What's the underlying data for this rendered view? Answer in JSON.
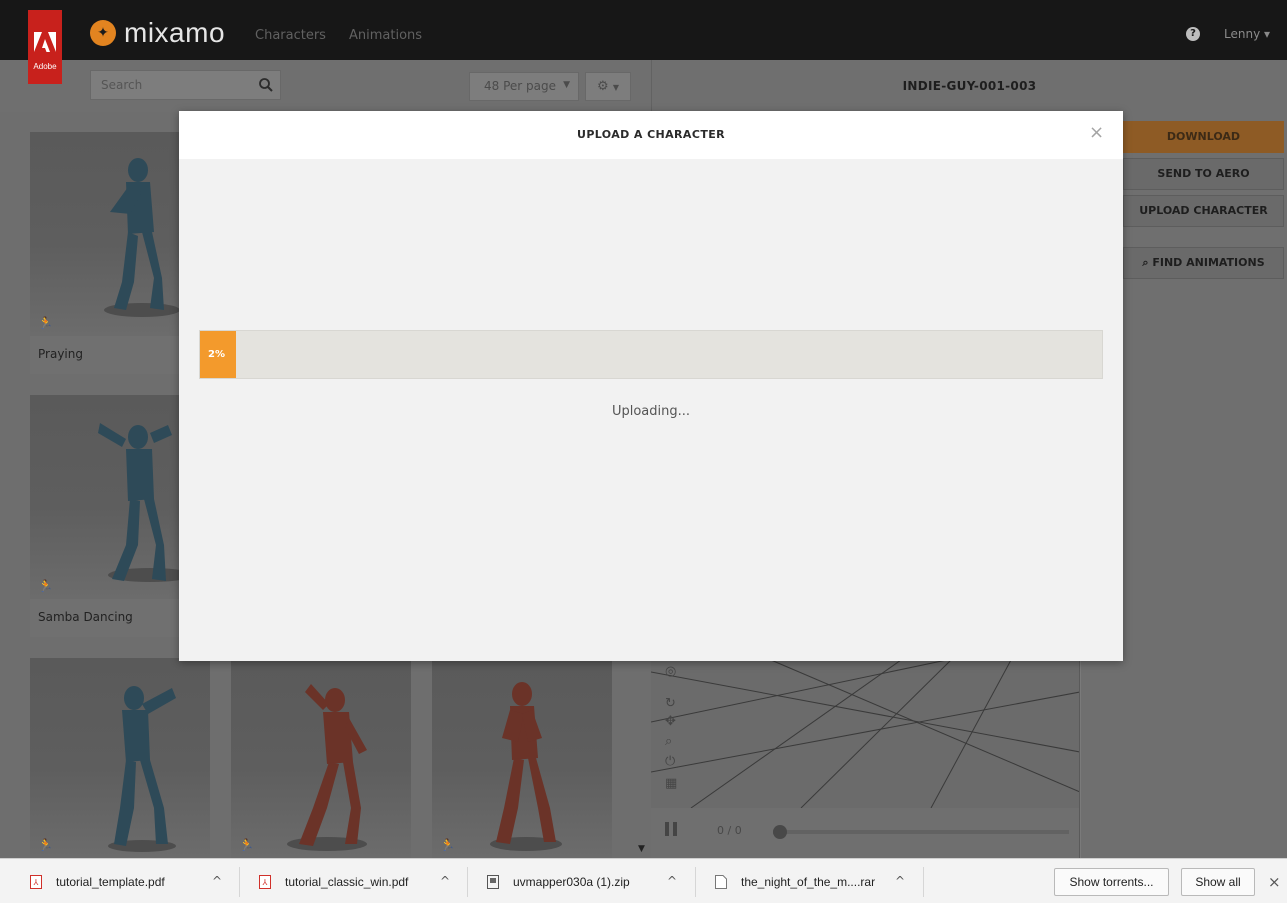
{
  "app": {
    "adobe_badge_label": "Adobe",
    "logo_text": "mixamo",
    "nav": [
      "Characters",
      "Animations"
    ],
    "user": "Lenny"
  },
  "toolbar": {
    "search_placeholder": "Search",
    "per_page": "48 Per page",
    "character_name": "INDIE-GUY-001-003"
  },
  "grid": {
    "cards": [
      {
        "label": "Praying",
        "color": "blue"
      },
      {
        "label": "Samba Dancing",
        "color": "blue"
      },
      {
        "label": "",
        "color": "blue"
      },
      {
        "label": "",
        "color": "red"
      },
      {
        "label": "",
        "color": "red"
      }
    ]
  },
  "viewer": {
    "frame_count": "0 / 0"
  },
  "right_panel": {
    "download": "DOWNLOAD",
    "send_to_aero": "SEND TO AERO",
    "upload_character": "UPLOAD CHARACTER",
    "find_animations": "FIND ANIMATIONS"
  },
  "modal": {
    "title": "UPLOAD A CHARACTER",
    "close": "×",
    "progress_percent": 2,
    "progress_label": "2%",
    "status": "Uploading..."
  },
  "downloads": {
    "items": [
      {
        "name": "tutorial_template.pdf",
        "type": "pdf"
      },
      {
        "name": "tutorial_classic_win.pdf",
        "type": "pdf"
      },
      {
        "name": "uvmapper030a (1).zip",
        "type": "zip"
      },
      {
        "name": "the_night_of_the_m....rar",
        "type": "file"
      }
    ],
    "show_torrents": "Show torrents...",
    "show_all": "Show all",
    "close": "×"
  },
  "colors": {
    "accent_orange": "#f39a2c",
    "adobe_red": "#c8211c",
    "figure_blue": "#2e4a58",
    "figure_red": "#6b3328"
  }
}
